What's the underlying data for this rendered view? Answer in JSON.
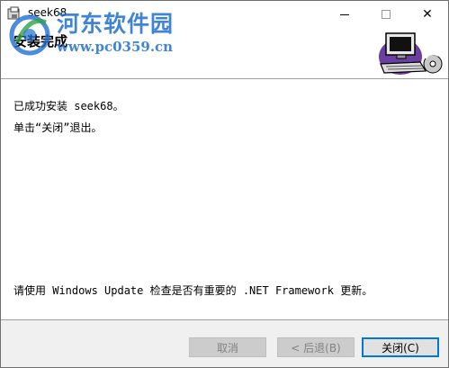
{
  "window": {
    "title": "seek68",
    "minimize_glyph": "",
    "maximize_glyph": "",
    "close_glyph": "✕"
  },
  "watermark": {
    "name": "河东软件园",
    "url": "www.pc0359.cn",
    "color": "#1f6fd1"
  },
  "header": {
    "title": "安装完成",
    "art_icon": "computer-cd-icon"
  },
  "messages": {
    "line1": "已成功安装 seek68。",
    "line2": "单击“关闭”退出。",
    "line3": "请使用 Windows Update 检查是否有重要的 .NET Framework 更新。"
  },
  "buttons": {
    "cancel": "取消",
    "back": "< 后退(B)",
    "close": "关闭(C)"
  },
  "colors": {
    "accent": "#0078d7",
    "footer_bg": "#f0f0f0",
    "disabled_bg": "#cccccc"
  }
}
